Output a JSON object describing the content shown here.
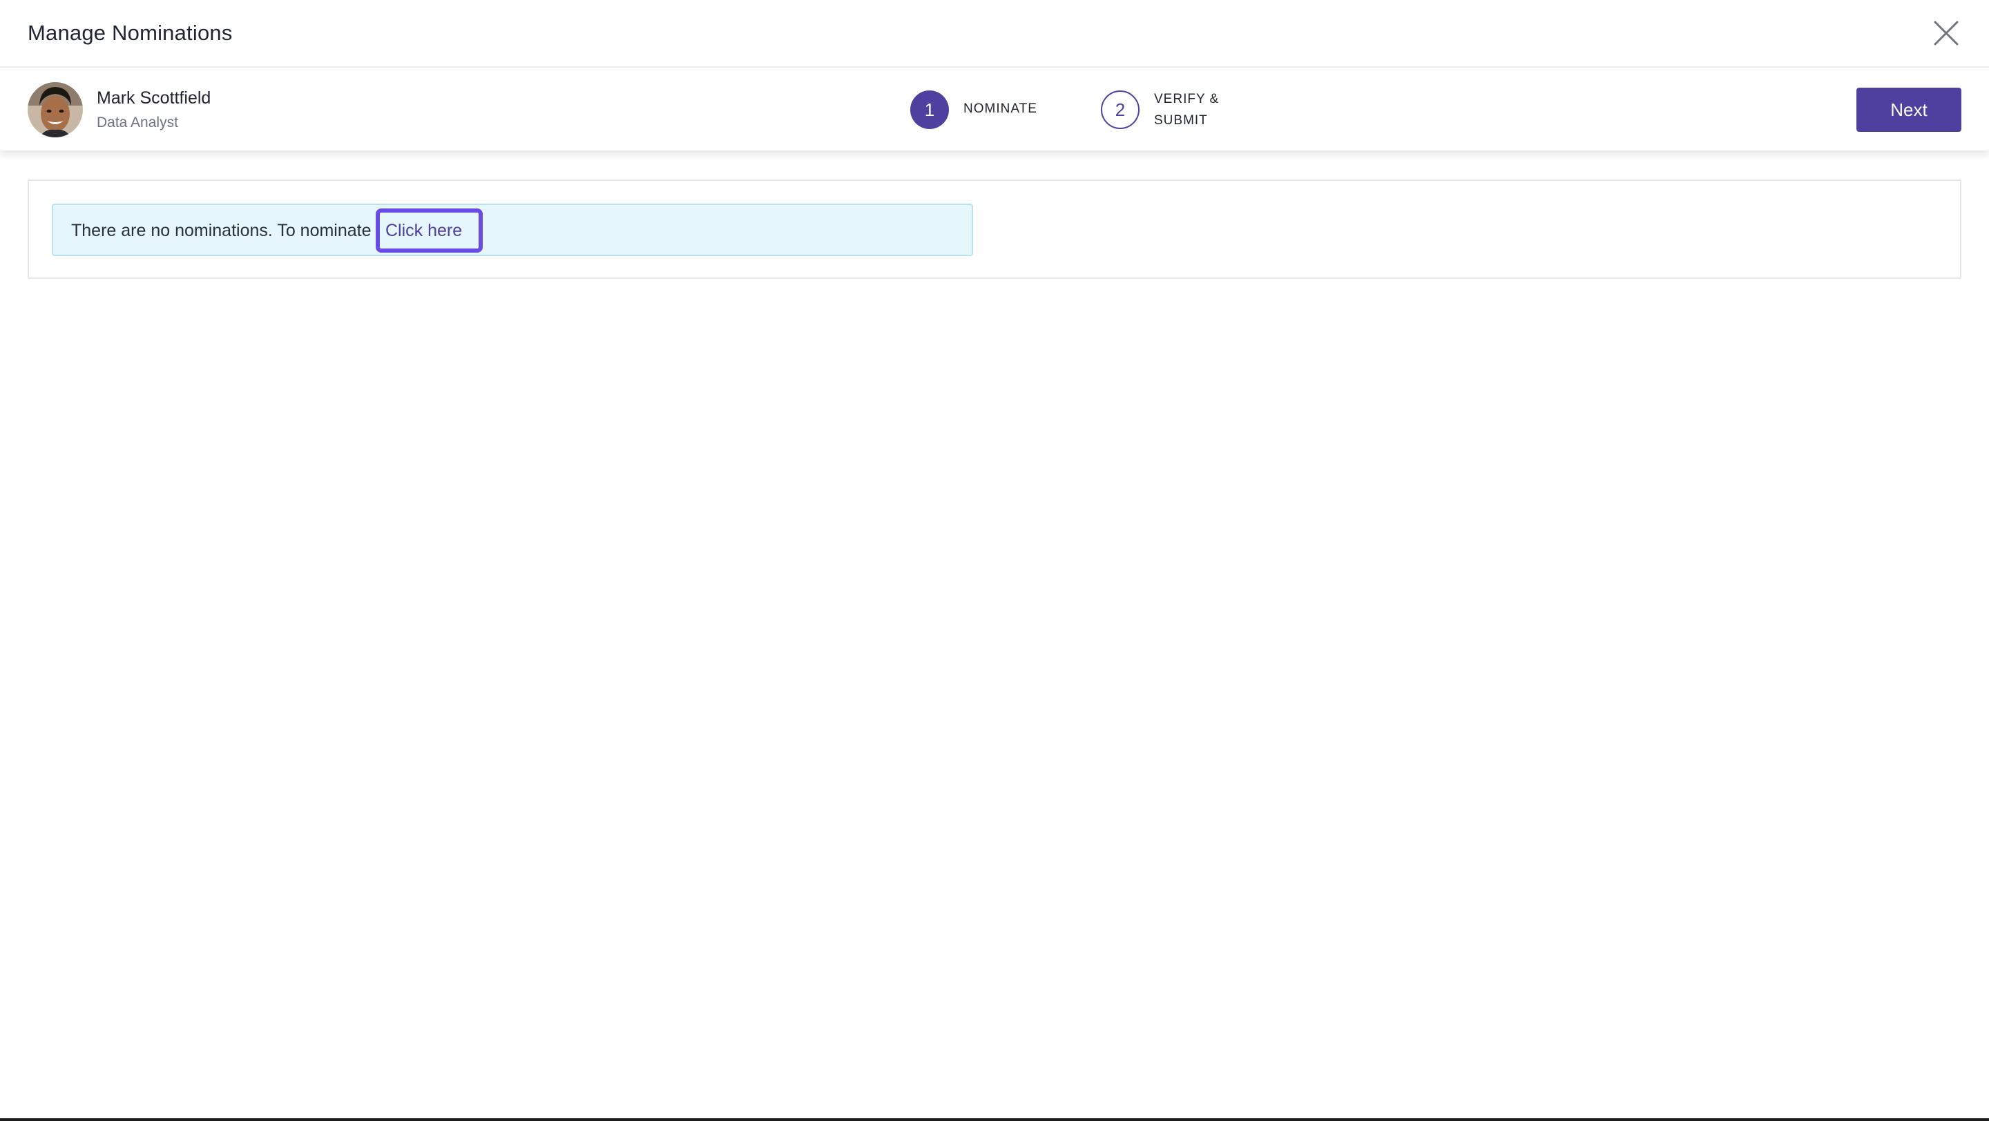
{
  "dialog": {
    "title": "Manage Nominations"
  },
  "profile": {
    "name": "Mark Scottfield",
    "role": "Data Analyst"
  },
  "stepper": {
    "steps": [
      {
        "number": "1",
        "label": "NOMINATE",
        "active": true
      },
      {
        "number": "2",
        "label": "VERIFY & SUBMIT",
        "active": false
      }
    ]
  },
  "actions": {
    "next_label": "Next"
  },
  "alert": {
    "message": "There are no nominations. To nominate",
    "link_label": "Click here"
  },
  "icons": {
    "close": "close-icon",
    "avatar": "user-avatar"
  },
  "colors": {
    "accent": "#4f3f9f",
    "alert_background": "#e5f6fd",
    "alert_border": "#b9e3f5",
    "focus_ring": "#6a4be6"
  }
}
